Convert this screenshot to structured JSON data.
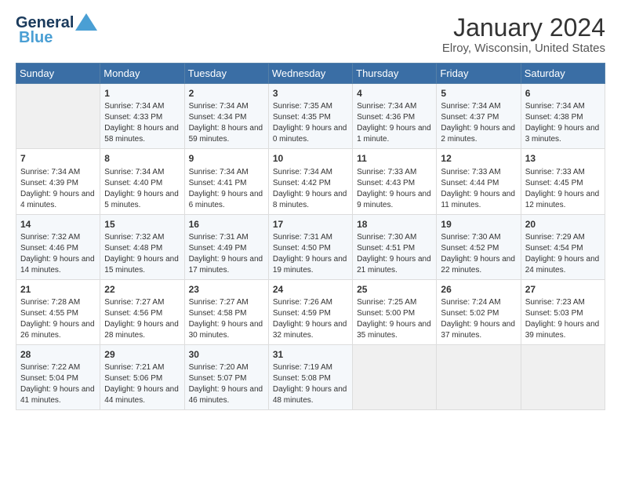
{
  "logo": {
    "general": "General",
    "blue": "Blue"
  },
  "title": "January 2024",
  "subtitle": "Elroy, Wisconsin, United States",
  "days_of_week": [
    "Sunday",
    "Monday",
    "Tuesday",
    "Wednesday",
    "Thursday",
    "Friday",
    "Saturday"
  ],
  "weeks": [
    [
      {
        "day": "",
        "empty": true
      },
      {
        "day": "1",
        "sunrise": "7:34 AM",
        "sunset": "4:33 PM",
        "daylight": "8 hours and 58 minutes."
      },
      {
        "day": "2",
        "sunrise": "7:34 AM",
        "sunset": "4:34 PM",
        "daylight": "8 hours and 59 minutes."
      },
      {
        "day": "3",
        "sunrise": "7:35 AM",
        "sunset": "4:35 PM",
        "daylight": "9 hours and 0 minutes."
      },
      {
        "day": "4",
        "sunrise": "7:34 AM",
        "sunset": "4:36 PM",
        "daylight": "9 hours and 1 minute."
      },
      {
        "day": "5",
        "sunrise": "7:34 AM",
        "sunset": "4:37 PM",
        "daylight": "9 hours and 2 minutes."
      },
      {
        "day": "6",
        "sunrise": "7:34 AM",
        "sunset": "4:38 PM",
        "daylight": "9 hours and 3 minutes."
      }
    ],
    [
      {
        "day": "7",
        "sunrise": "7:34 AM",
        "sunset": "4:39 PM",
        "daylight": "9 hours and 4 minutes."
      },
      {
        "day": "8",
        "sunrise": "7:34 AM",
        "sunset": "4:40 PM",
        "daylight": "9 hours and 5 minutes."
      },
      {
        "day": "9",
        "sunrise": "7:34 AM",
        "sunset": "4:41 PM",
        "daylight": "9 hours and 6 minutes."
      },
      {
        "day": "10",
        "sunrise": "7:34 AM",
        "sunset": "4:42 PM",
        "daylight": "9 hours and 8 minutes."
      },
      {
        "day": "11",
        "sunrise": "7:33 AM",
        "sunset": "4:43 PM",
        "daylight": "9 hours and 9 minutes."
      },
      {
        "day": "12",
        "sunrise": "7:33 AM",
        "sunset": "4:44 PM",
        "daylight": "9 hours and 11 minutes."
      },
      {
        "day": "13",
        "sunrise": "7:33 AM",
        "sunset": "4:45 PM",
        "daylight": "9 hours and 12 minutes."
      }
    ],
    [
      {
        "day": "14",
        "sunrise": "7:32 AM",
        "sunset": "4:46 PM",
        "daylight": "9 hours and 14 minutes."
      },
      {
        "day": "15",
        "sunrise": "7:32 AM",
        "sunset": "4:48 PM",
        "daylight": "9 hours and 15 minutes."
      },
      {
        "day": "16",
        "sunrise": "7:31 AM",
        "sunset": "4:49 PM",
        "daylight": "9 hours and 17 minutes."
      },
      {
        "day": "17",
        "sunrise": "7:31 AM",
        "sunset": "4:50 PM",
        "daylight": "9 hours and 19 minutes."
      },
      {
        "day": "18",
        "sunrise": "7:30 AM",
        "sunset": "4:51 PM",
        "daylight": "9 hours and 21 minutes."
      },
      {
        "day": "19",
        "sunrise": "7:30 AM",
        "sunset": "4:52 PM",
        "daylight": "9 hours and 22 minutes."
      },
      {
        "day": "20",
        "sunrise": "7:29 AM",
        "sunset": "4:54 PM",
        "daylight": "9 hours and 24 minutes."
      }
    ],
    [
      {
        "day": "21",
        "sunrise": "7:28 AM",
        "sunset": "4:55 PM",
        "daylight": "9 hours and 26 minutes."
      },
      {
        "day": "22",
        "sunrise": "7:27 AM",
        "sunset": "4:56 PM",
        "daylight": "9 hours and 28 minutes."
      },
      {
        "day": "23",
        "sunrise": "7:27 AM",
        "sunset": "4:58 PM",
        "daylight": "9 hours and 30 minutes."
      },
      {
        "day": "24",
        "sunrise": "7:26 AM",
        "sunset": "4:59 PM",
        "daylight": "9 hours and 32 minutes."
      },
      {
        "day": "25",
        "sunrise": "7:25 AM",
        "sunset": "5:00 PM",
        "daylight": "9 hours and 35 minutes."
      },
      {
        "day": "26",
        "sunrise": "7:24 AM",
        "sunset": "5:02 PM",
        "daylight": "9 hours and 37 minutes."
      },
      {
        "day": "27",
        "sunrise": "7:23 AM",
        "sunset": "5:03 PM",
        "daylight": "9 hours and 39 minutes."
      }
    ],
    [
      {
        "day": "28",
        "sunrise": "7:22 AM",
        "sunset": "5:04 PM",
        "daylight": "9 hours and 41 minutes."
      },
      {
        "day": "29",
        "sunrise": "7:21 AM",
        "sunset": "5:06 PM",
        "daylight": "9 hours and 44 minutes."
      },
      {
        "day": "30",
        "sunrise": "7:20 AM",
        "sunset": "5:07 PM",
        "daylight": "9 hours and 46 minutes."
      },
      {
        "day": "31",
        "sunrise": "7:19 AM",
        "sunset": "5:08 PM",
        "daylight": "9 hours and 48 minutes."
      },
      {
        "day": "",
        "empty": true
      },
      {
        "day": "",
        "empty": true
      },
      {
        "day": "",
        "empty": true
      }
    ]
  ],
  "labels": {
    "sunrise": "Sunrise:",
    "sunset": "Sunset:",
    "daylight": "Daylight:"
  }
}
